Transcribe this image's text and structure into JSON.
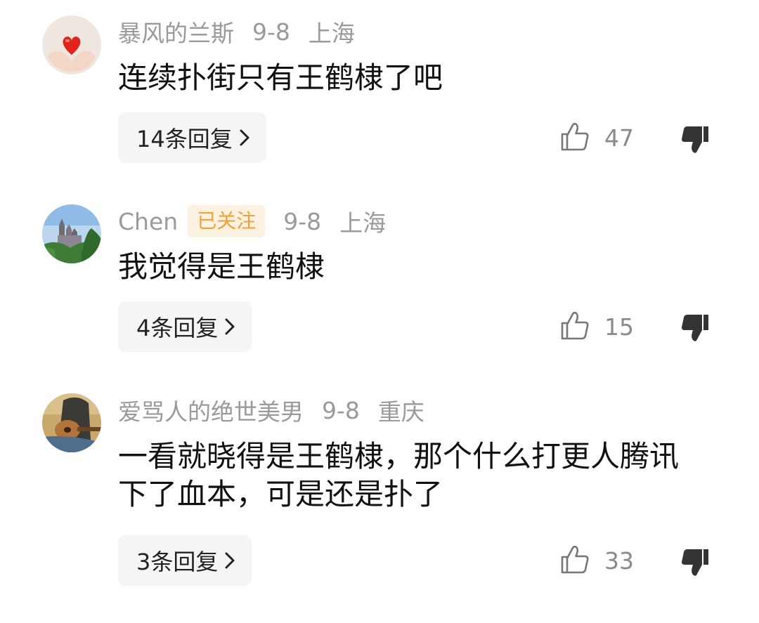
{
  "comments": [
    {
      "username": "暴风的兰斯",
      "badge": "",
      "date": "9-8",
      "location": "上海",
      "text": "连续扑街只有王鹤棣了吧",
      "reply_label": "14条回复",
      "likes": "47",
      "avatar": "heart-in-hands"
    },
    {
      "username": "Chen",
      "badge": "已关注",
      "date": "9-8",
      "location": "上海",
      "text": "我觉得是王鹤棣",
      "reply_label": "4条回复",
      "likes": "15",
      "avatar": "castle-landscape"
    },
    {
      "username": "爱骂人的绝世美男",
      "badge": "",
      "date": "9-8",
      "location": "重庆",
      "text": "一看就晓得是王鹤棣，那个什么打更人腾讯下了血本，可是还是扑了",
      "reply_label": "3条回复",
      "likes": "33",
      "avatar": "guitar-player"
    }
  ],
  "icons": {
    "like": "thumbs-up-icon",
    "dislike": "thumbs-down-icon",
    "reply_arrow": "chevron-right-icon"
  },
  "colors": {
    "meta": "#9a9a9a",
    "badge_bg": "#fdf1e1",
    "badge_text": "#f0a23a",
    "reply_bg": "#f5f5f5"
  }
}
